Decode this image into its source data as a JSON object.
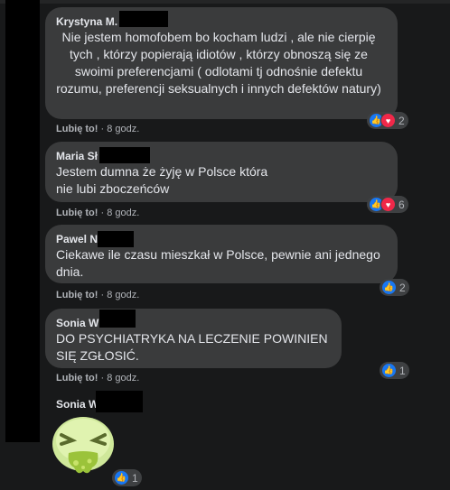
{
  "comments": [
    {
      "author": "Krystyna M.",
      "text": "Nie jestem homofobem bo kocham ludzi , ale nie cierpię tych , którzy popierają idiotów , którzy obnoszą się ze swoimi preferencjami ( odlotami tj odnośnie defektu rozumu, preferencji seksualnych i innych defektów natury)",
      "like_label": "Lubię to!",
      "time": "8 godz.",
      "reaction_count": "2",
      "reactions": [
        "like-icon",
        "love-icon"
      ]
    },
    {
      "author": "Maria Sł",
      "text": "Jestem dumna że żyję w Polsce która nie lubi zboczeńców",
      "like_label": "Lubię to!",
      "time": "8 godz.",
      "reaction_count": "6",
      "reactions": [
        "like-icon",
        "love-icon"
      ]
    },
    {
      "author": "Pawel N",
      "text": "Ciekawe ile czasu mieszkał w Polsce, pewnie ani jednego dnia.",
      "like_label": "Lubię to!",
      "time": "8 godz.",
      "reaction_count": "2",
      "reactions": [
        "like-icon"
      ]
    },
    {
      "author": "Sonia W",
      "text": "DO PSYCHIATRYKA NA LECZENIE POWINIEN SIĘ ZGŁOSIĆ.",
      "like_label": "Lubię to!",
      "time": "8 godz.",
      "reaction_count": "1",
      "reactions": [
        "like-icon"
      ]
    },
    {
      "author": "Sonia W",
      "sticker": "vomiting-face-sticker",
      "reaction_count": "1",
      "reactions": [
        "like-icon"
      ]
    }
  ],
  "colors": {
    "background": "#18191a",
    "bubble": "#3a3b3c",
    "like": "#1877f2",
    "love": "#f02849",
    "muted_text": "#b0b3b8"
  }
}
